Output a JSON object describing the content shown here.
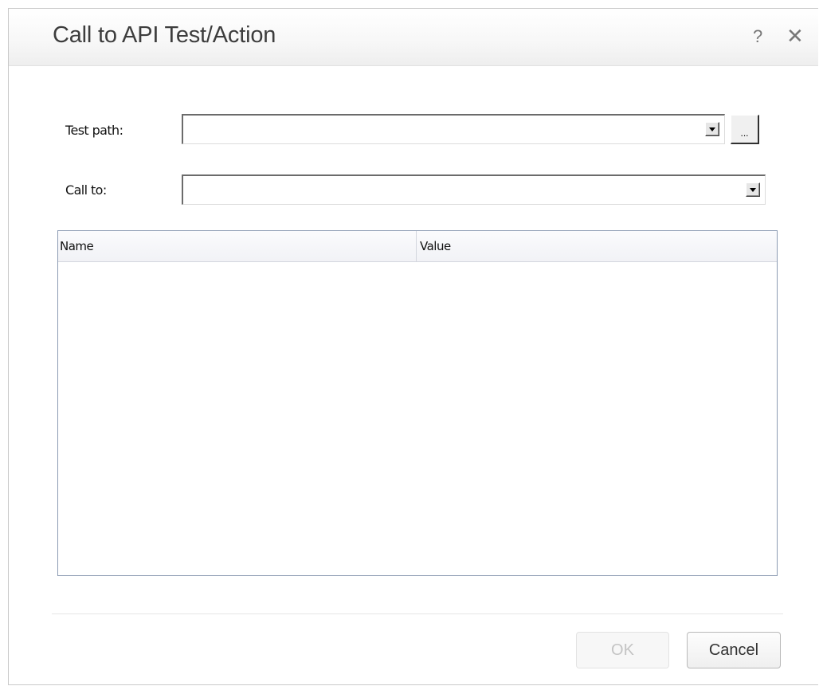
{
  "dialog": {
    "title": "Call to API Test/Action",
    "help_glyph": "?",
    "close_glyph": "✕"
  },
  "form": {
    "test_path": {
      "label": "Test path:",
      "value": "",
      "browse_label": "..."
    },
    "call_to": {
      "label": "Call to:",
      "value": ""
    }
  },
  "parameters_table": {
    "columns": [
      "Name",
      "Value"
    ],
    "rows": []
  },
  "buttons": {
    "ok_label": "OK",
    "ok_enabled": false,
    "cancel_label": "Cancel"
  },
  "icons": {
    "help": "help-icon",
    "close": "close-icon",
    "dropdown": "dropdown-arrow-icon"
  },
  "colors": {
    "title_text": "#3d3d3d",
    "grid_border": "#8c9bb3",
    "disabled_text": "#c4c4c4"
  }
}
